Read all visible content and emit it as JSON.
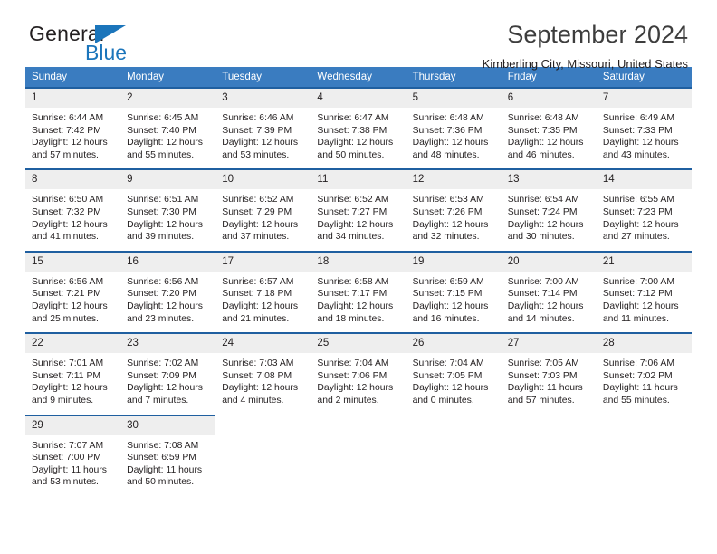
{
  "brand": {
    "name_part1": "General",
    "name_part2": "Blue",
    "flag_icon": "triangle-flag-icon"
  },
  "header": {
    "title": "September 2024",
    "location": "Kimberling City, Missouri, United States"
  },
  "colors": {
    "header_row": "#3a7cc0",
    "cell_top_border": "#1f5fa0",
    "daynum_bg": "#eeeeee",
    "brand_blue": "#1b75bb",
    "title_text": "#3d3d3d",
    "body_text": "#231f20"
  },
  "weekday_headers": [
    "Sunday",
    "Monday",
    "Tuesday",
    "Wednesday",
    "Thursday",
    "Friday",
    "Saturday"
  ],
  "weeks": [
    [
      {
        "day": "1",
        "sunrise": "Sunrise: 6:44 AM",
        "sunset": "Sunset: 7:42 PM",
        "daylight1": "Daylight: 12 hours",
        "daylight2": "and 57 minutes."
      },
      {
        "day": "2",
        "sunrise": "Sunrise: 6:45 AM",
        "sunset": "Sunset: 7:40 PM",
        "daylight1": "Daylight: 12 hours",
        "daylight2": "and 55 minutes."
      },
      {
        "day": "3",
        "sunrise": "Sunrise: 6:46 AM",
        "sunset": "Sunset: 7:39 PM",
        "daylight1": "Daylight: 12 hours",
        "daylight2": "and 53 minutes."
      },
      {
        "day": "4",
        "sunrise": "Sunrise: 6:47 AM",
        "sunset": "Sunset: 7:38 PM",
        "daylight1": "Daylight: 12 hours",
        "daylight2": "and 50 minutes."
      },
      {
        "day": "5",
        "sunrise": "Sunrise: 6:48 AM",
        "sunset": "Sunset: 7:36 PM",
        "daylight1": "Daylight: 12 hours",
        "daylight2": "and 48 minutes."
      },
      {
        "day": "6",
        "sunrise": "Sunrise: 6:48 AM",
        "sunset": "Sunset: 7:35 PM",
        "daylight1": "Daylight: 12 hours",
        "daylight2": "and 46 minutes."
      },
      {
        "day": "7",
        "sunrise": "Sunrise: 6:49 AM",
        "sunset": "Sunset: 7:33 PM",
        "daylight1": "Daylight: 12 hours",
        "daylight2": "and 43 minutes."
      }
    ],
    [
      {
        "day": "8",
        "sunrise": "Sunrise: 6:50 AM",
        "sunset": "Sunset: 7:32 PM",
        "daylight1": "Daylight: 12 hours",
        "daylight2": "and 41 minutes."
      },
      {
        "day": "9",
        "sunrise": "Sunrise: 6:51 AM",
        "sunset": "Sunset: 7:30 PM",
        "daylight1": "Daylight: 12 hours",
        "daylight2": "and 39 minutes."
      },
      {
        "day": "10",
        "sunrise": "Sunrise: 6:52 AM",
        "sunset": "Sunset: 7:29 PM",
        "daylight1": "Daylight: 12 hours",
        "daylight2": "and 37 minutes."
      },
      {
        "day": "11",
        "sunrise": "Sunrise: 6:52 AM",
        "sunset": "Sunset: 7:27 PM",
        "daylight1": "Daylight: 12 hours",
        "daylight2": "and 34 minutes."
      },
      {
        "day": "12",
        "sunrise": "Sunrise: 6:53 AM",
        "sunset": "Sunset: 7:26 PM",
        "daylight1": "Daylight: 12 hours",
        "daylight2": "and 32 minutes."
      },
      {
        "day": "13",
        "sunrise": "Sunrise: 6:54 AM",
        "sunset": "Sunset: 7:24 PM",
        "daylight1": "Daylight: 12 hours",
        "daylight2": "and 30 minutes."
      },
      {
        "day": "14",
        "sunrise": "Sunrise: 6:55 AM",
        "sunset": "Sunset: 7:23 PM",
        "daylight1": "Daylight: 12 hours",
        "daylight2": "and 27 minutes."
      }
    ],
    [
      {
        "day": "15",
        "sunrise": "Sunrise: 6:56 AM",
        "sunset": "Sunset: 7:21 PM",
        "daylight1": "Daylight: 12 hours",
        "daylight2": "and 25 minutes."
      },
      {
        "day": "16",
        "sunrise": "Sunrise: 6:56 AM",
        "sunset": "Sunset: 7:20 PM",
        "daylight1": "Daylight: 12 hours",
        "daylight2": "and 23 minutes."
      },
      {
        "day": "17",
        "sunrise": "Sunrise: 6:57 AM",
        "sunset": "Sunset: 7:18 PM",
        "daylight1": "Daylight: 12 hours",
        "daylight2": "and 21 minutes."
      },
      {
        "day": "18",
        "sunrise": "Sunrise: 6:58 AM",
        "sunset": "Sunset: 7:17 PM",
        "daylight1": "Daylight: 12 hours",
        "daylight2": "and 18 minutes."
      },
      {
        "day": "19",
        "sunrise": "Sunrise: 6:59 AM",
        "sunset": "Sunset: 7:15 PM",
        "daylight1": "Daylight: 12 hours",
        "daylight2": "and 16 minutes."
      },
      {
        "day": "20",
        "sunrise": "Sunrise: 7:00 AM",
        "sunset": "Sunset: 7:14 PM",
        "daylight1": "Daylight: 12 hours",
        "daylight2": "and 14 minutes."
      },
      {
        "day": "21",
        "sunrise": "Sunrise: 7:00 AM",
        "sunset": "Sunset: 7:12 PM",
        "daylight1": "Daylight: 12 hours",
        "daylight2": "and 11 minutes."
      }
    ],
    [
      {
        "day": "22",
        "sunrise": "Sunrise: 7:01 AM",
        "sunset": "Sunset: 7:11 PM",
        "daylight1": "Daylight: 12 hours",
        "daylight2": "and 9 minutes."
      },
      {
        "day": "23",
        "sunrise": "Sunrise: 7:02 AM",
        "sunset": "Sunset: 7:09 PM",
        "daylight1": "Daylight: 12 hours",
        "daylight2": "and 7 minutes."
      },
      {
        "day": "24",
        "sunrise": "Sunrise: 7:03 AM",
        "sunset": "Sunset: 7:08 PM",
        "daylight1": "Daylight: 12 hours",
        "daylight2": "and 4 minutes."
      },
      {
        "day": "25",
        "sunrise": "Sunrise: 7:04 AM",
        "sunset": "Sunset: 7:06 PM",
        "daylight1": "Daylight: 12 hours",
        "daylight2": "and 2 minutes."
      },
      {
        "day": "26",
        "sunrise": "Sunrise: 7:04 AM",
        "sunset": "Sunset: 7:05 PM",
        "daylight1": "Daylight: 12 hours",
        "daylight2": "and 0 minutes."
      },
      {
        "day": "27",
        "sunrise": "Sunrise: 7:05 AM",
        "sunset": "Sunset: 7:03 PM",
        "daylight1": "Daylight: 11 hours",
        "daylight2": "and 57 minutes."
      },
      {
        "day": "28",
        "sunrise": "Sunrise: 7:06 AM",
        "sunset": "Sunset: 7:02 PM",
        "daylight1": "Daylight: 11 hours",
        "daylight2": "and 55 minutes."
      }
    ],
    [
      {
        "day": "29",
        "sunrise": "Sunrise: 7:07 AM",
        "sunset": "Sunset: 7:00 PM",
        "daylight1": "Daylight: 11 hours",
        "daylight2": "and 53 minutes."
      },
      {
        "day": "30",
        "sunrise": "Sunrise: 7:08 AM",
        "sunset": "Sunset: 6:59 PM",
        "daylight1": "Daylight: 11 hours",
        "daylight2": "and 50 minutes."
      },
      {
        "day": "",
        "sunrise": "",
        "sunset": "",
        "daylight1": "",
        "daylight2": ""
      },
      {
        "day": "",
        "sunrise": "",
        "sunset": "",
        "daylight1": "",
        "daylight2": ""
      },
      {
        "day": "",
        "sunrise": "",
        "sunset": "",
        "daylight1": "",
        "daylight2": ""
      },
      {
        "day": "",
        "sunrise": "",
        "sunset": "",
        "daylight1": "",
        "daylight2": ""
      },
      {
        "day": "",
        "sunrise": "",
        "sunset": "",
        "daylight1": "",
        "daylight2": ""
      }
    ]
  ]
}
